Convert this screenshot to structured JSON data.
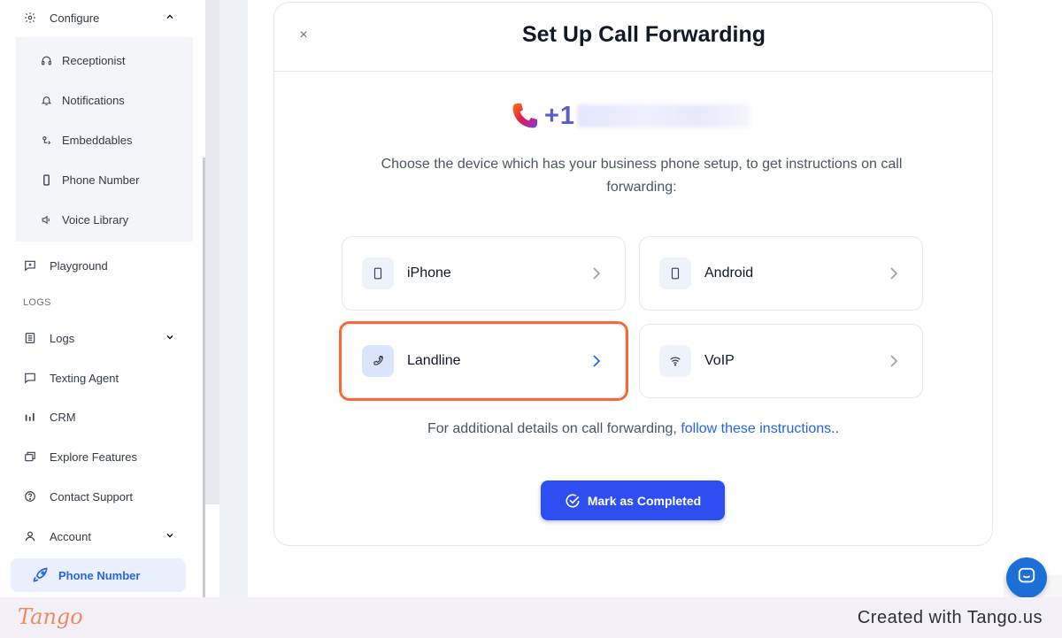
{
  "sidebar": {
    "configure_label": "Configure",
    "sub_items": [
      {
        "label": "Receptionist",
        "icon": "headset-icon"
      },
      {
        "label": "Notifications",
        "icon": "bell-icon"
      },
      {
        "label": "Embeddables",
        "icon": "embed-icon"
      },
      {
        "label": "Phone Number",
        "icon": "smartphone-icon"
      },
      {
        "label": "Voice Library",
        "icon": "speaker-icon"
      }
    ],
    "playground_label": "Playground",
    "logs_section": "LOGS",
    "items": [
      {
        "label": "Logs",
        "icon": "list-icon"
      },
      {
        "label": "Texting Agent",
        "icon": "message-icon"
      },
      {
        "label": "CRM",
        "icon": "bar-chart-icon"
      },
      {
        "label": "Explore Features",
        "icon": "layers-icon"
      },
      {
        "label": "Contact Support",
        "icon": "help-circle-icon"
      },
      {
        "label": "Account",
        "icon": "user-icon"
      }
    ],
    "active_item": {
      "label": "Phone Number",
      "icon": "rocket-icon"
    }
  },
  "modal": {
    "title": "Set Up Call Forwarding",
    "close_glyph": "×",
    "phone_prefix": "+1",
    "instruction": "Choose the device which has your business phone setup, to get instructions on call forwarding:",
    "devices": [
      {
        "label": "iPhone",
        "icon": "smartphone-icon"
      },
      {
        "label": "Android",
        "icon": "smartphone-icon"
      },
      {
        "label": "Landline",
        "icon": "phone-icon",
        "selected": true
      },
      {
        "label": "VoIP",
        "icon": "wifi-icon"
      }
    ],
    "additional_prefix": "For additional details on call forwarding, ",
    "additional_link": "follow these instructions",
    "additional_suffix": "..",
    "complete_button": "Mark as Completed"
  },
  "footer": {
    "logo_text": "Tango",
    "created_text": "Created with Tango.us"
  },
  "colors": {
    "accent": "#2e4ef2",
    "link": "#2563eb",
    "highlight": "#f26b3a",
    "phone_text": "#5b5fc7"
  }
}
